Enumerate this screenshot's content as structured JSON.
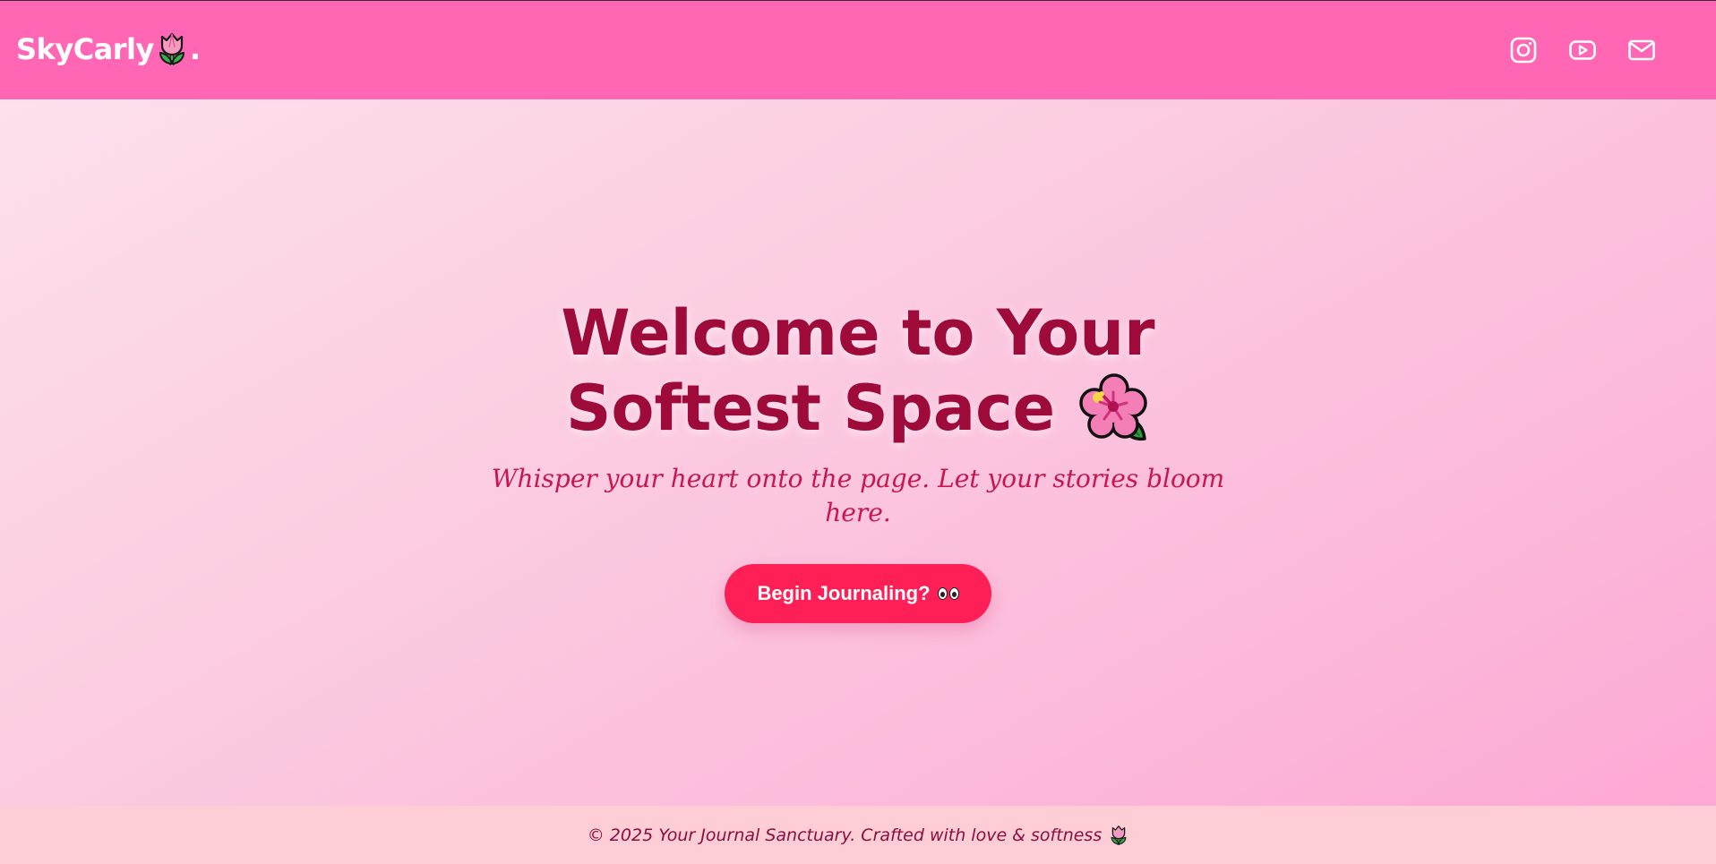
{
  "header": {
    "brand_name": "SkyCarly",
    "brand_dot": ".",
    "brand_icon": "tulip-icon",
    "background": "#ff66b4",
    "social": [
      {
        "name": "instagram",
        "icon": "instagram-icon"
      },
      {
        "name": "youtube",
        "icon": "youtube-icon"
      },
      {
        "name": "email",
        "icon": "mail-icon"
      }
    ]
  },
  "hero": {
    "title_line1": "Welcome to Your",
    "title_line2": "Softest Space",
    "title_icon": "hibiscus-icon",
    "subtitle": "Whisper your heart onto the page. Let your stories bloom here.",
    "cta_label": "Begin Journaling?",
    "cta_icon": "eyes-icon",
    "title_color": "#9e0b3a",
    "subtitle_color": "#c8174f",
    "cta_color": "#ff1f57"
  },
  "footer": {
    "text": "© 2025 Your Journal Sanctuary. Crafted with love & softness",
    "icon": "tulip-icon",
    "background": "#ffcdd6"
  }
}
